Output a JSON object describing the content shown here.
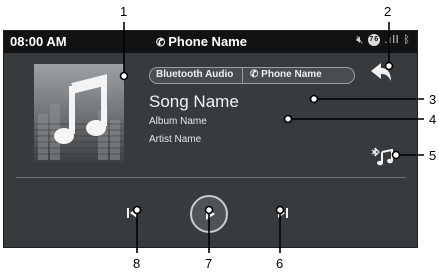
{
  "status_bar": {
    "time": "08:00 AM",
    "phone_name": "Phone Name",
    "phone_icon": "phone-icon",
    "icons": [
      "mute-icon",
      "notification-badge-icon",
      "signal-bars-icon",
      "bluetooth-icon"
    ],
    "badge_text": "76"
  },
  "source_bar": {
    "source_label": "Bluetooth Audio",
    "device_label": "Phone Name",
    "device_icon": "phone-icon"
  },
  "now_playing": {
    "song": "Song Name",
    "album": "Album Name",
    "artist": "Artist Name"
  },
  "icons": {
    "album_art": "music-note-icon",
    "back": "back-arrow-icon",
    "bluetooth_music": "bluetooth-music-icon",
    "prev": "skip-previous-icon",
    "play": "play-icon",
    "next": "skip-next-icon"
  },
  "callouts": [
    "1",
    "2",
    "3",
    "4",
    "5",
    "6",
    "7",
    "8"
  ],
  "colors": {
    "screen_bg": "#383b3d",
    "status_bg": "#111213",
    "text": "#f2f2f2",
    "accent_ring": "#c9cbcd"
  }
}
